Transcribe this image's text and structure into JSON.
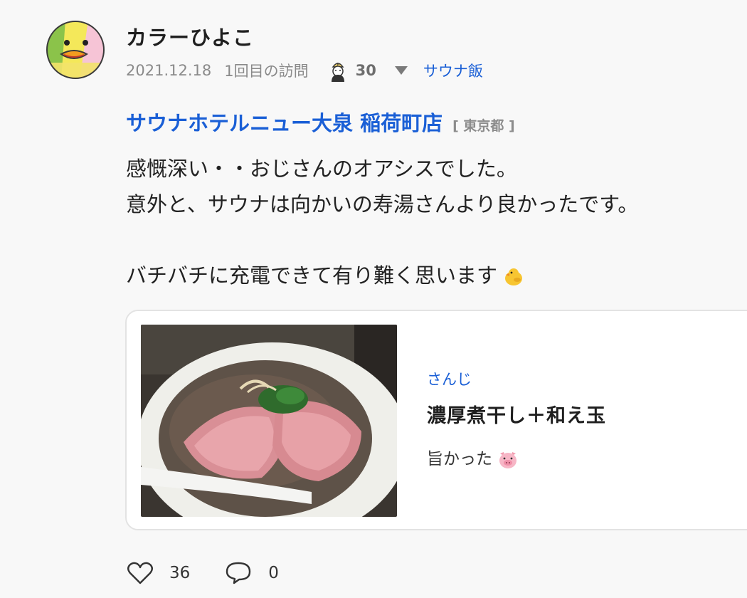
{
  "post": {
    "author": "カラーひよこ",
    "date": "2021.12.18",
    "visit": "1回目の訪問",
    "sauna_man_count": "30",
    "tag": "サウナ飯",
    "facility_name": "サウナホテルニュー大泉 稲荷町店",
    "prefecture": "[ 東京都 ]",
    "body_lines": [
      "感慨深い・・おじさんのオアシスでした。",
      "意外と、サウナは向かいの寿湯さんより良かったです。",
      "",
      "バチバチに充電できて有り難く思います"
    ],
    "body_emoji": "chick-icon"
  },
  "meal_card": {
    "restaurant": "さんじ",
    "dish": "濃厚煮干し＋和え玉",
    "comment": "旨かった",
    "comment_emoji": "pig-face-icon",
    "photo": "ramen-photo"
  },
  "actions": {
    "likes": "36",
    "comments": "0"
  },
  "colors": {
    "link": "#1a5fd6",
    "meta": "#8a8a8a",
    "background": "#f8f8f8"
  }
}
